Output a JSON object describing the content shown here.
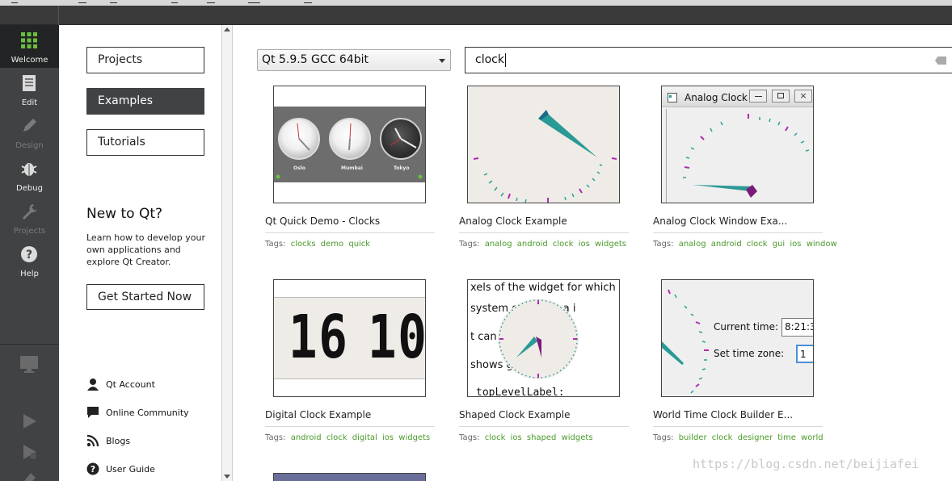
{
  "modebar": {
    "items": [
      {
        "label": "Welcome",
        "icon": "grid-icon",
        "active": true
      },
      {
        "label": "Edit",
        "icon": "document-icon"
      },
      {
        "label": "Design",
        "icon": "pencil-icon",
        "disabled": true
      },
      {
        "label": "Debug",
        "icon": "bug-icon"
      },
      {
        "label": "Projects",
        "icon": "wrench-icon",
        "disabled": true
      },
      {
        "label": "Help",
        "icon": "help-icon"
      }
    ]
  },
  "sidebar": {
    "projects_label": "Projects",
    "examples_label": "Examples",
    "tutorials_label": "Tutorials",
    "new_to_qt_title": "New to Qt?",
    "learn_text": "Learn how to develop your own applications and explore Qt Creator.",
    "get_started_label": "Get Started Now",
    "links": [
      {
        "label": "Qt Account",
        "icon": "user-icon"
      },
      {
        "label": "Online Community",
        "icon": "chat-icon"
      },
      {
        "label": "Blogs",
        "icon": "rss-icon"
      },
      {
        "label": "User Guide",
        "icon": "help-icon"
      }
    ]
  },
  "main": {
    "kit_value": "Qt 5.9.5 GCC 64bit",
    "search_value": "clock",
    "tags_prefix": "Tags:",
    "examples": [
      {
        "title": "Qt Quick Demo - Clocks",
        "tags": [
          "clocks",
          "demo",
          "quick"
        ]
      },
      {
        "title": "Analog Clock Example",
        "tags": [
          "analog",
          "android",
          "clock",
          "ios",
          "widgets"
        ]
      },
      {
        "title": "Analog Clock Window Exa...",
        "tags": [
          "analog",
          "android",
          "clock",
          "gui",
          "ios",
          "window"
        ]
      },
      {
        "title": "Digital Clock Example",
        "tags": [
          "android",
          "clock",
          "digital",
          "ios",
          "widgets"
        ]
      },
      {
        "title": "Shaped Clock Example",
        "tags": [
          "clock",
          "ios",
          "shaped",
          "widgets"
        ]
      },
      {
        "title": "World Time Clock Builder E...",
        "tags": [
          "builder",
          "clock",
          "designer",
          "time",
          "world"
        ]
      }
    ],
    "thumb_text": {
      "city_oslo": "Oslo",
      "city_mumbai": "Mumbai",
      "city_tokyo": "Tokyo",
      "window_title": "Analog Clock",
      "lcd_hours": "16",
      "lcd_minutes": "10",
      "shaped_line1": "xels of the widget for which bi",
      "shaped_line2": "system o      that area i",
      "shaped_line3": "t can b          gion is p",
      "shaped_line4": "shows          ge with ar",
      "shaped_line5": "topLevelLabel:",
      "wtb_current_label": "Current time:",
      "wtb_current_value": "8:21:3",
      "wtb_zone_label": "Set time zone:",
      "wtb_zone_value": "1"
    }
  },
  "watermark": "https://blog.csdn.net/beijiafei",
  "colors": {
    "modebar_bg": "#404244",
    "active_button": "#404244",
    "tag_green": "#4a9a2a"
  }
}
